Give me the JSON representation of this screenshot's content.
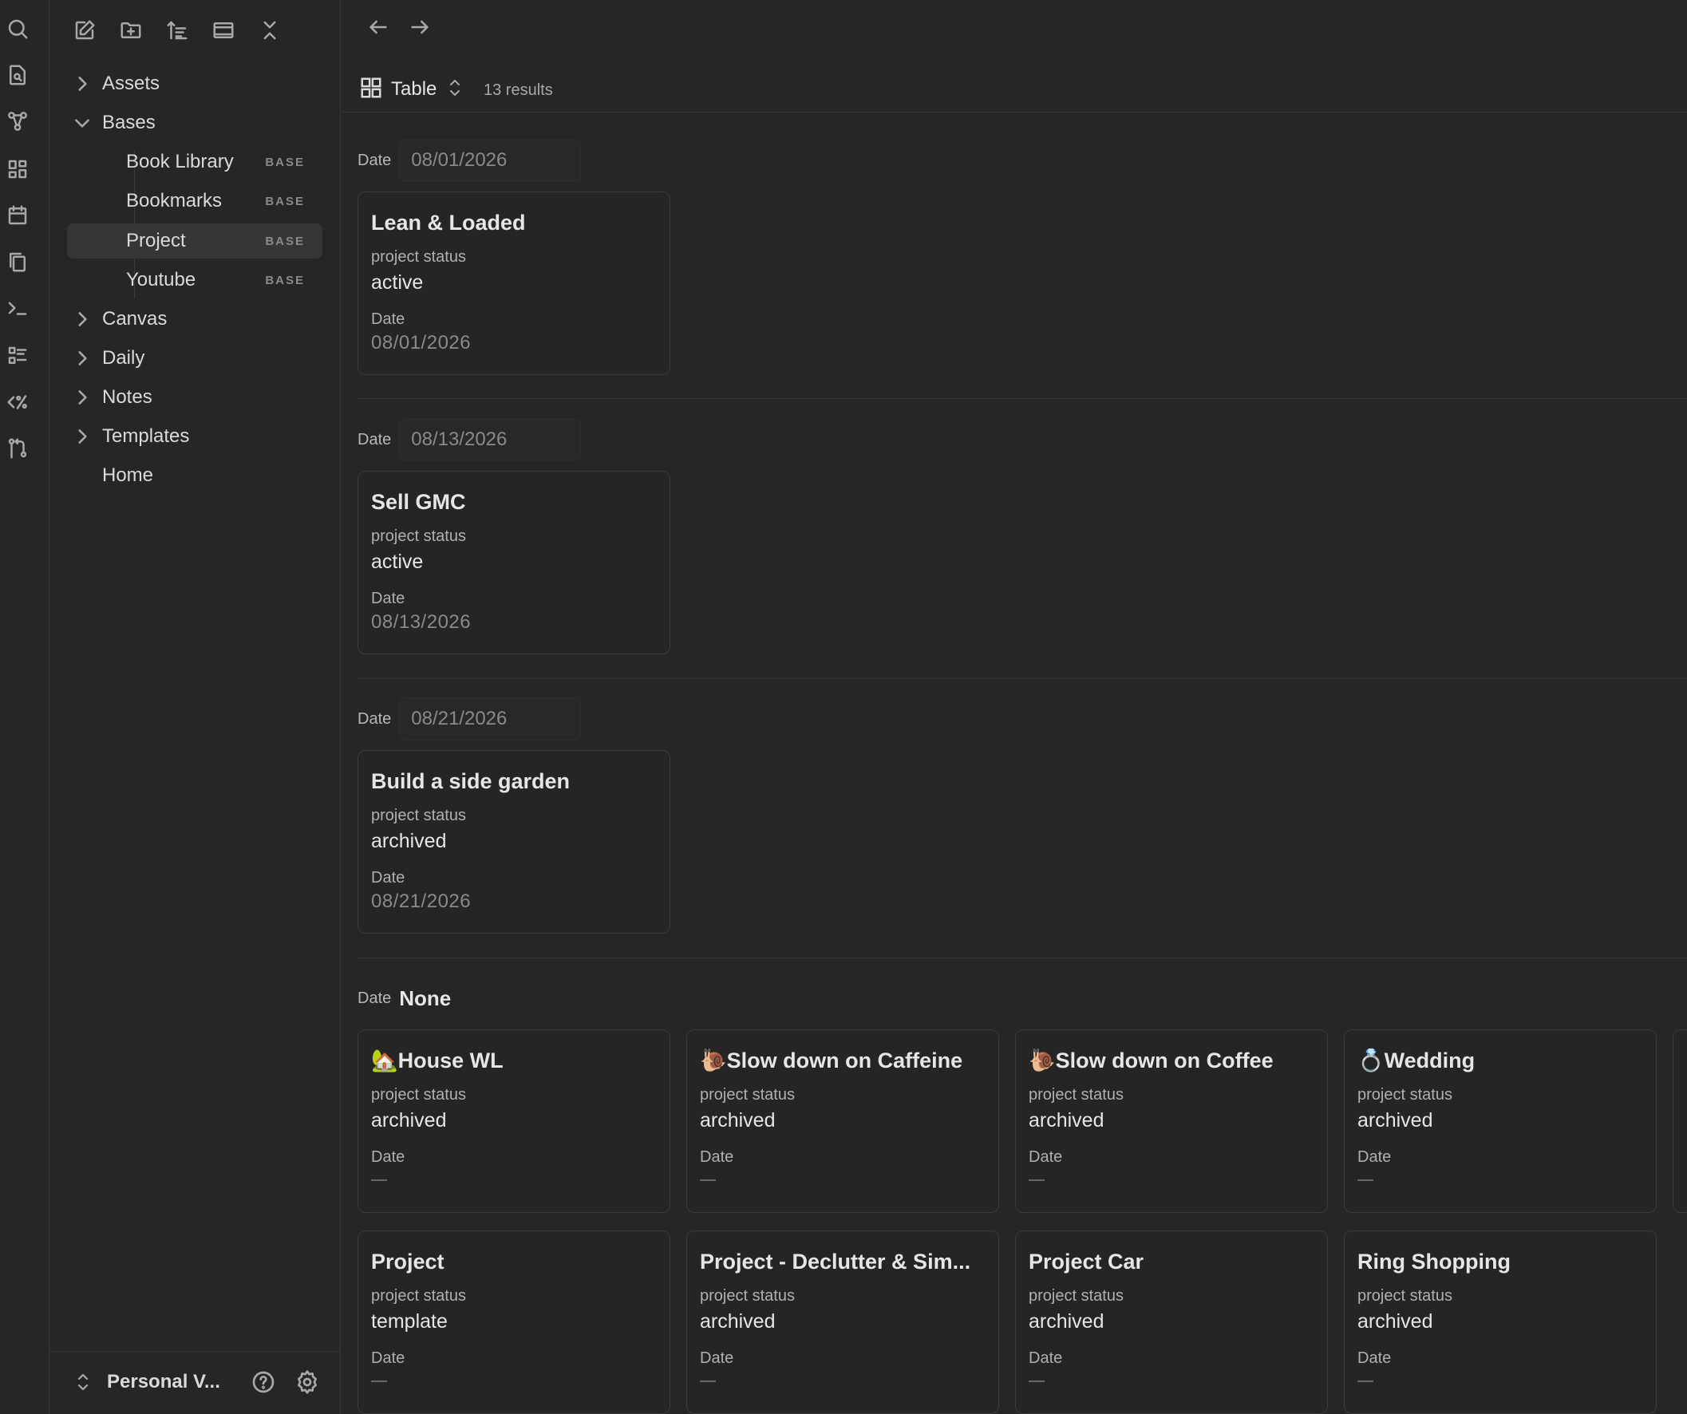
{
  "sidebar": {
    "tree": [
      {
        "label": "Assets",
        "expanded": false
      },
      {
        "label": "Bases",
        "expanded": true
      },
      {
        "label": "Book Library",
        "badge": "BASE"
      },
      {
        "label": "Bookmarks",
        "badge": "BASE"
      },
      {
        "label": "Project",
        "badge": "BASE",
        "active": true
      },
      {
        "label": "Youtube",
        "badge": "BASE"
      },
      {
        "label": "Canvas",
        "expanded": false
      },
      {
        "label": "Daily",
        "expanded": false
      },
      {
        "label": "Notes",
        "expanded": false
      },
      {
        "label": "Templates",
        "expanded": false
      },
      {
        "label": "Home"
      }
    ],
    "vault_name": "Personal V..."
  },
  "main": {
    "view_label": "Table",
    "results": "13 results",
    "group_key": "Date",
    "groups": [
      {
        "value": "08/01/2026",
        "card": {
          "title": "Lean & Loaded",
          "prop1": "project status",
          "status": "active",
          "prop2": "Date",
          "date": "08/01/2026"
        }
      },
      {
        "value": "08/13/2026",
        "card": {
          "title": "Sell GMC",
          "prop1": "project status",
          "status": "active",
          "prop2": "Date",
          "date": "08/13/2026"
        }
      },
      {
        "value": "08/21/2026",
        "card": {
          "title": "Build a side garden",
          "prop1": "project status",
          "status": "archived",
          "prop2": "Date",
          "date": "08/21/2026"
        }
      }
    ],
    "none_group": {
      "value": "None",
      "cards": [
        {
          "title": "🏡House WL",
          "prop1": "project status",
          "status": "archived",
          "prop2": "Date"
        },
        {
          "title": "🐌Slow down on Caffeine",
          "prop1": "project status",
          "status": "archived",
          "prop2": "Date"
        },
        {
          "title": "🐌Slow down on Coffee",
          "prop1": "project status",
          "status": "archived",
          "prop2": "Date"
        },
        {
          "title": "💍Wedding",
          "prop1": "project status",
          "status": "archived",
          "prop2": "Date"
        },
        {
          "title": "Project",
          "prop1": "project status",
          "status": "template",
          "prop2": "Date"
        },
        {
          "title": "Project - Declutter & Sim...",
          "prop1": "project status",
          "status": "archived",
          "prop2": "Date"
        },
        {
          "title": "Project Car",
          "prop1": "project status",
          "status": "archived",
          "prop2": "Date"
        },
        {
          "title": "Ring Shopping",
          "prop1": "project status",
          "status": "archived",
          "prop2": "Date"
        }
      ]
    }
  }
}
